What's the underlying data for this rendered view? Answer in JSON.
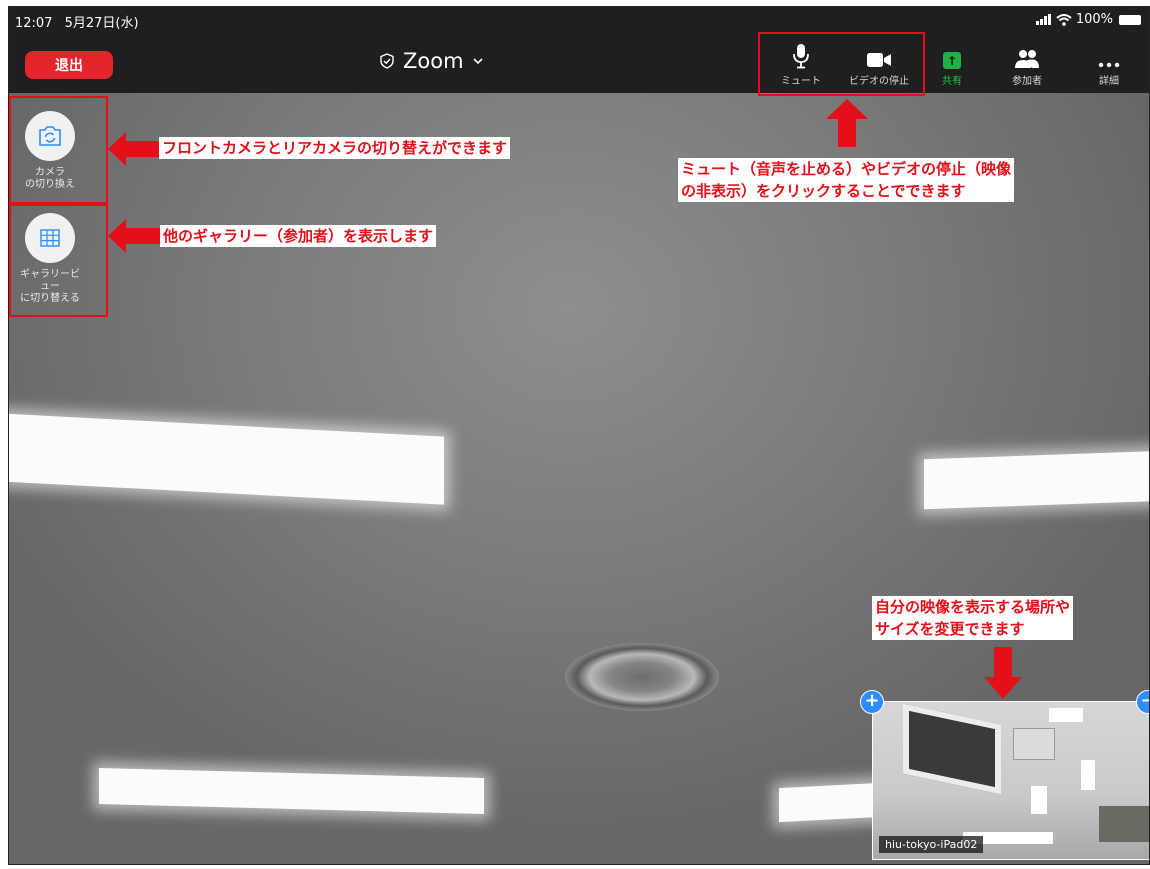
{
  "status_bar": {
    "time": "12:07",
    "date": "5月27日(水)",
    "battery": "100%"
  },
  "toolbar": {
    "leave_label": "退出",
    "meeting_title": "Zoom",
    "mute_label": "ミュート",
    "stop_video_label": "ビデオの停止",
    "share_label": "共有",
    "participants_label": "参加者",
    "more_label": "詳細"
  },
  "side_buttons": {
    "switch_camera_label": "カメラ\nの切り換え",
    "gallery_view_label": "ギャラリービ\nュー\nに切り替える"
  },
  "annotations": {
    "camera_switch": "フロントカメラとリアカメラの切り替えができます",
    "gallery": "他のギャラリー（参加者）を表示します",
    "mute_video_line1": "ミュート（音声を止める）やビデオの停止（映像",
    "mute_video_line2": "の非表示）をクリックすることでできます",
    "self_view_line1": "自分の映像を表示する場所や",
    "self_view_line2": "サイズを変更できます"
  },
  "self_view": {
    "name": "hiu-tokyo-iPad02"
  },
  "colors": {
    "leave_red": "#e3252c",
    "annotation_red": "#e3101a",
    "share_green": "#1fb146",
    "handle_blue": "#2d8cff",
    "toolbar_bg": "#1f1f1f"
  }
}
